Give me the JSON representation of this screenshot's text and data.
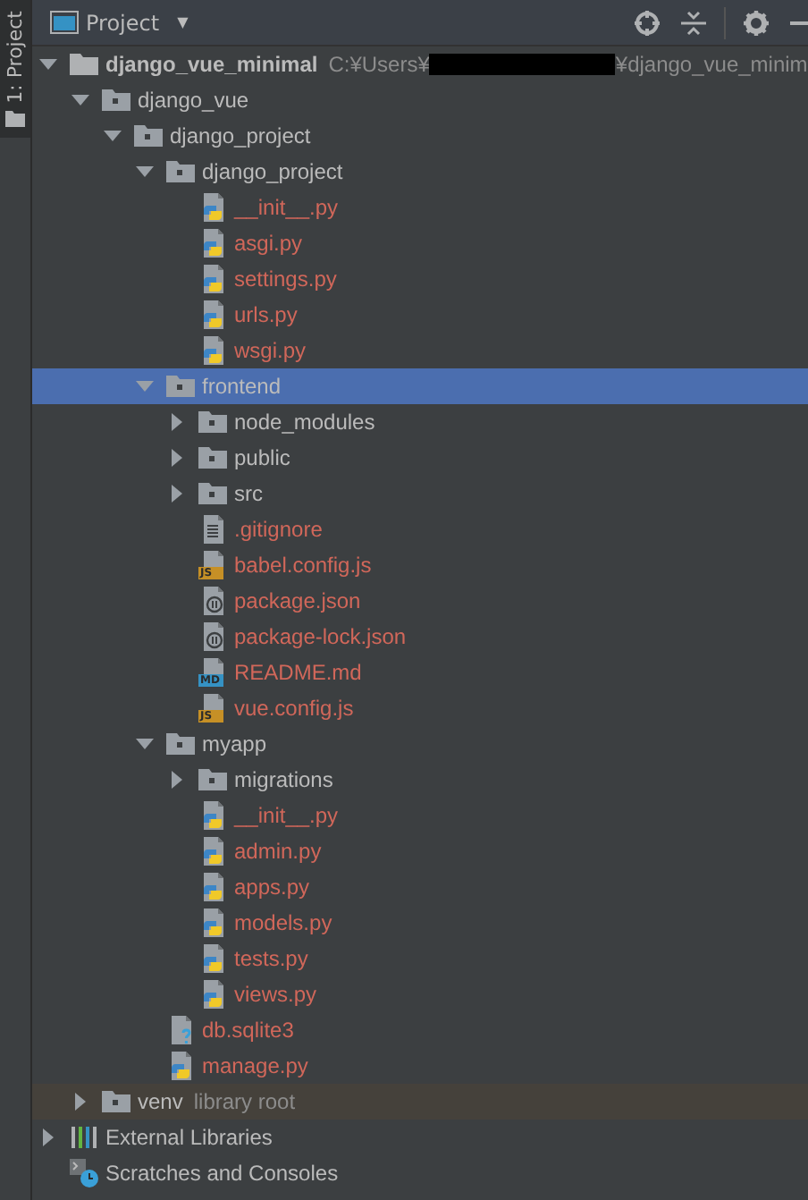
{
  "sidebar": {
    "tab_label": "1: Project"
  },
  "header": {
    "title": "Project",
    "caret": "▼"
  },
  "tree": [
    {
      "name": "django_vue_minimal",
      "kind": "project-folder",
      "expanded": true,
      "selected": false,
      "unversioned": false,
      "path": [
        "C:¥Users¥",
        "¥django_vue_minim"
      ],
      "children": [
        {
          "name": "django_vue",
          "kind": "module-folder",
          "expanded": true,
          "selected": false,
          "unversioned": false,
          "children": [
            {
              "name": "django_project",
              "kind": "module-folder",
              "expanded": true,
              "selected": false,
              "unversioned": false,
              "children": [
                {
                  "name": "django_project",
                  "kind": "module-folder",
                  "expanded": true,
                  "selected": false,
                  "unversioned": false,
                  "children": [
                    {
                      "name": "__init__.py",
                      "kind": "python",
                      "selected": false,
                      "unversioned": true
                    },
                    {
                      "name": "asgi.py",
                      "kind": "python",
                      "selected": false,
                      "unversioned": true
                    },
                    {
                      "name": "settings.py",
                      "kind": "python",
                      "selected": false,
                      "unversioned": true
                    },
                    {
                      "name": "urls.py",
                      "kind": "python",
                      "selected": false,
                      "unversioned": true
                    },
                    {
                      "name": "wsgi.py",
                      "kind": "python",
                      "selected": false,
                      "unversioned": true
                    }
                  ]
                },
                {
                  "name": "frontend",
                  "kind": "module-folder",
                  "expanded": true,
                  "selected": true,
                  "unversioned": false,
                  "children": [
                    {
                      "name": "node_modules",
                      "kind": "module-folder",
                      "expanded": false,
                      "selected": false,
                      "unversioned": false
                    },
                    {
                      "name": "public",
                      "kind": "module-folder",
                      "expanded": false,
                      "selected": false,
                      "unversioned": false
                    },
                    {
                      "name": "src",
                      "kind": "module-folder",
                      "expanded": false,
                      "selected": false,
                      "unversioned": false
                    },
                    {
                      "name": ".gitignore",
                      "kind": "text",
                      "selected": false,
                      "unversioned": true
                    },
                    {
                      "name": "babel.config.js",
                      "kind": "js",
                      "badge": "JS",
                      "selected": false,
                      "unversioned": true
                    },
                    {
                      "name": "package.json",
                      "kind": "json",
                      "selected": false,
                      "unversioned": true
                    },
                    {
                      "name": "package-lock.json",
                      "kind": "json",
                      "selected": false,
                      "unversioned": true
                    },
                    {
                      "name": "README.md",
                      "kind": "md",
                      "badge": "MD",
                      "selected": false,
                      "unversioned": true
                    },
                    {
                      "name": "vue.config.js",
                      "kind": "js",
                      "badge": "JS",
                      "selected": false,
                      "unversioned": true
                    }
                  ]
                },
                {
                  "name": "myapp",
                  "kind": "module-folder",
                  "expanded": true,
                  "selected": false,
                  "unversioned": false,
                  "children": [
                    {
                      "name": "migrations",
                      "kind": "module-folder",
                      "expanded": false,
                      "selected": false,
                      "unversioned": false
                    },
                    {
                      "name": "__init__.py",
                      "kind": "python",
                      "selected": false,
                      "unversioned": true
                    },
                    {
                      "name": "admin.py",
                      "kind": "python",
                      "selected": false,
                      "unversioned": true
                    },
                    {
                      "name": "apps.py",
                      "kind": "python",
                      "selected": false,
                      "unversioned": true
                    },
                    {
                      "name": "models.py",
                      "kind": "python",
                      "selected": false,
                      "unversioned": true
                    },
                    {
                      "name": "tests.py",
                      "kind": "python",
                      "selected": false,
                      "unversioned": true
                    },
                    {
                      "name": "views.py",
                      "kind": "python",
                      "selected": false,
                      "unversioned": true
                    }
                  ]
                },
                {
                  "name": "db.sqlite3",
                  "kind": "unknown",
                  "selected": false,
                  "unversioned": true
                },
                {
                  "name": "manage.py",
                  "kind": "python",
                  "selected": false,
                  "unversioned": true
                }
              ]
            }
          ]
        },
        {
          "name": "venv",
          "kind": "module-folder",
          "expanded": false,
          "selected": false,
          "unversioned": false,
          "excluded": true,
          "note": "library root"
        }
      ]
    },
    {
      "name": "External Libraries",
      "kind": "libraries",
      "expanded": false,
      "selected": false,
      "unversioned": false
    },
    {
      "name": "Scratches and Consoles",
      "kind": "scratches",
      "selected": false,
      "unversioned": false
    }
  ]
}
